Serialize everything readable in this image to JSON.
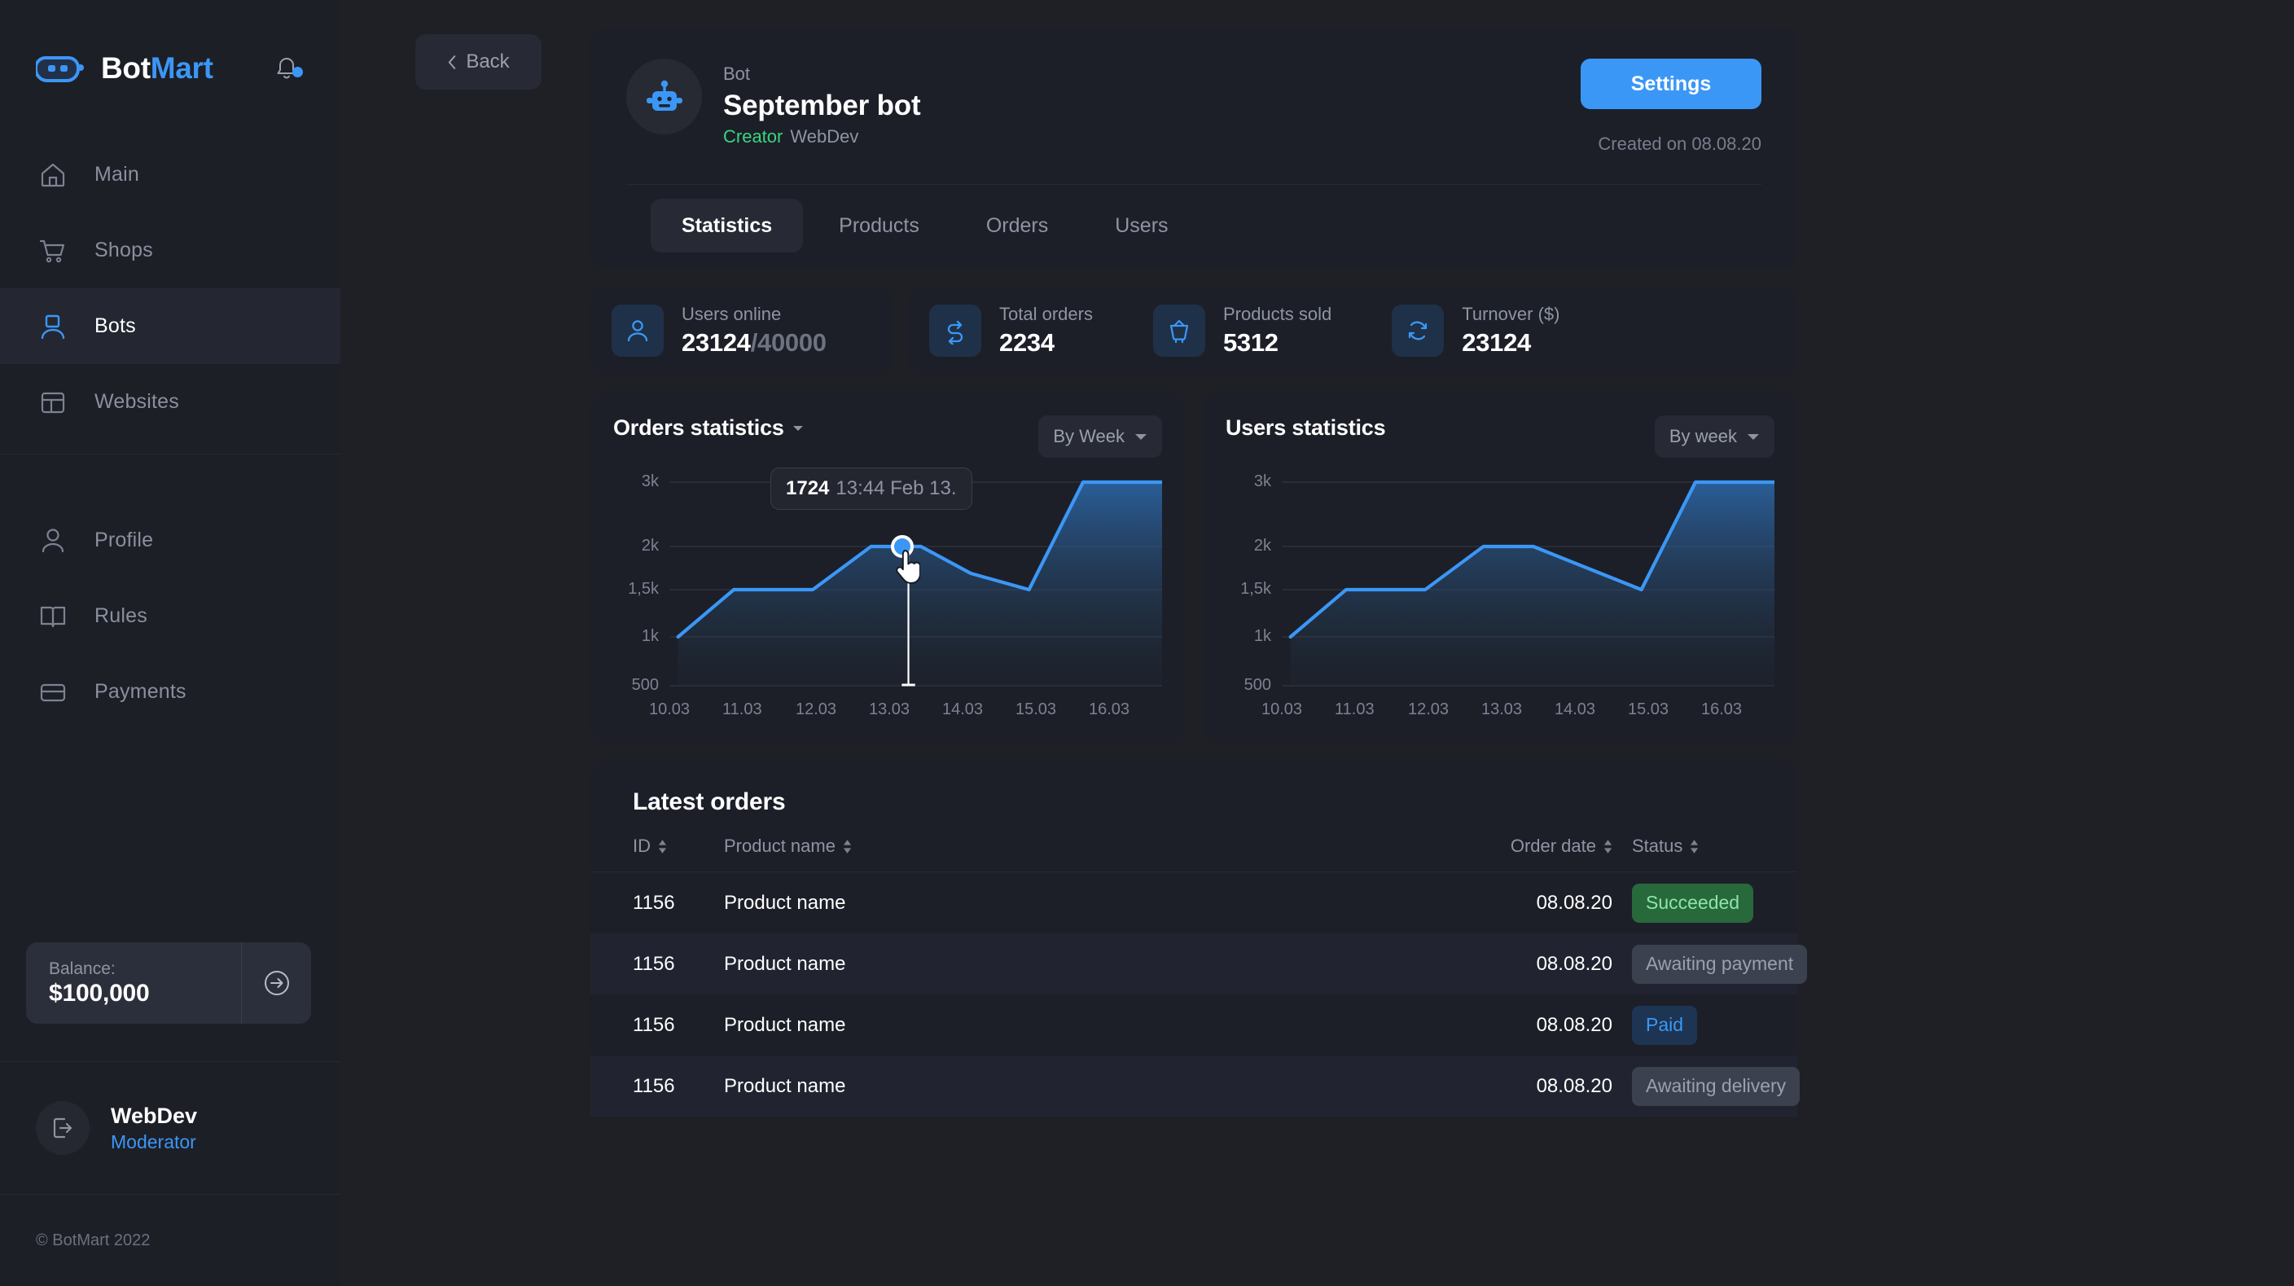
{
  "brand": {
    "name_white": "Bot",
    "name_blue": "Mart"
  },
  "sidebar": {
    "items": [
      {
        "label": "Main",
        "icon": "home-icon"
      },
      {
        "label": "Shops",
        "icon": "cart-icon"
      },
      {
        "label": "Bots",
        "icon": "bot-user-icon"
      },
      {
        "label": "Websites",
        "icon": "layout-icon"
      },
      {
        "label": "Profile",
        "icon": "person-icon"
      },
      {
        "label": "Rules",
        "icon": "book-icon"
      },
      {
        "label": "Payments",
        "icon": "card-icon"
      }
    ],
    "active_item": "Bots",
    "balance": {
      "label": "Balance:",
      "value": "$100,000",
      "arrow_icon": "arrow-right-circle-icon"
    },
    "user": {
      "name": "WebDev",
      "role": "Moderator",
      "avatar_icon": "logout-icon"
    },
    "copyright": "© BotMart 2022"
  },
  "topbar": {
    "back_label": "Back",
    "back_icon": "chevron-left-icon"
  },
  "bot": {
    "kind_label": "Bot",
    "title": "September bot",
    "creator_label": "Creator",
    "creator_name": "WebDev",
    "settings_label": "Settings",
    "created_on": "Created on 08.08.20",
    "avatar_icon": "robot-icon"
  },
  "tabs": [
    {
      "label": "Statistics",
      "active": true
    },
    {
      "label": "Products",
      "active": false
    },
    {
      "label": "Orders",
      "active": false
    },
    {
      "label": "Users",
      "active": false
    }
  ],
  "stats": [
    {
      "label": "Users online",
      "value": "23124",
      "value_dim": "/40000",
      "icon": "person-icon"
    },
    {
      "label": "Total orders",
      "value": "2234",
      "value_dim": "",
      "icon": "shuffle-icon"
    },
    {
      "label": "Products sold",
      "value": "5312",
      "value_dim": "",
      "icon": "basket-icon"
    },
    {
      "label": "Turnover ($)",
      "value": "23124",
      "value_dim": "",
      "icon": "refresh-icon"
    }
  ],
  "charts": {
    "orders": {
      "title": "Orders statistics",
      "title_caret_icon": "caret-down-icon",
      "selector": "By Week",
      "selector_caret_icon": "caret-down-icon",
      "tooltip": {
        "value": "1724",
        "timestamp": "13:44 Feb 13."
      },
      "cursor_icon": "pointing-hand-cursor"
    },
    "users": {
      "title": "Users statistics",
      "selector": "By week",
      "selector_caret_icon": "caret-down-icon"
    }
  },
  "chart_data": [
    {
      "type": "area",
      "title": "Orders statistics",
      "xlabel": "",
      "ylabel": "",
      "grid": true,
      "legend": "none",
      "x": [
        "10.03",
        "11.03",
        "12.03",
        "13.03",
        "14.03",
        "15.03",
        "16.03"
      ],
      "ytick_labels": [
        "3k",
        "2k",
        "1,5k",
        "1k",
        "500"
      ],
      "ytick_values": [
        3000,
        2000,
        1500,
        1000,
        500
      ],
      "ylim": [
        500,
        3000
      ],
      "series": [
        {
          "name": "Orders",
          "values": [
            1000,
            1500,
            1500,
            2000,
            1724,
            1500,
            3000,
            3000
          ],
          "color": "#3b97f6"
        }
      ],
      "highlight_point": {
        "x": "13.03",
        "value": 1724,
        "label": "1724 13:44 Feb 13."
      }
    },
    {
      "type": "area",
      "title": "Users statistics",
      "xlabel": "",
      "ylabel": "",
      "grid": true,
      "legend": "none",
      "x": [
        "10.03",
        "11.03",
        "12.03",
        "13.03",
        "14.03",
        "15.03",
        "16.03"
      ],
      "ytick_labels": [
        "3k",
        "2k",
        "1,5k",
        "1k",
        "500"
      ],
      "ytick_values": [
        3000,
        2000,
        1500,
        1000,
        500
      ],
      "ylim": [
        500,
        3000
      ],
      "series": [
        {
          "name": "Users",
          "values": [
            1000,
            1500,
            1500,
            2000,
            2000,
            1500,
            3000,
            3000
          ],
          "color": "#3b97f6"
        }
      ]
    }
  ],
  "orders_table": {
    "title": "Latest orders",
    "columns": [
      {
        "label": "ID",
        "sortable": true
      },
      {
        "label": "Product name",
        "sortable": true
      },
      {
        "label": "Order date",
        "sortable": true
      },
      {
        "label": "Status",
        "sortable": true
      }
    ],
    "rows": [
      {
        "id": "1156",
        "product": "Product name",
        "date": "08.08.20",
        "status": "Succeeded",
        "status_kind": "succeeded"
      },
      {
        "id": "1156",
        "product": "Product name",
        "date": "08.08.20",
        "status": "Awaiting payment",
        "status_kind": "awaiting"
      },
      {
        "id": "1156",
        "product": "Product name",
        "date": "08.08.20",
        "status": "Paid",
        "status_kind": "paid"
      },
      {
        "id": "1156",
        "product": "Product name",
        "date": "08.08.20",
        "status": "Awaiting delivery",
        "status_kind": "awaiting"
      }
    ]
  },
  "colors": {
    "accent": "#3b97f6",
    "success": "#3ad47e",
    "bg": "#1e2025",
    "panel": "#1c1f28",
    "sidebar": "#1d1f26"
  }
}
